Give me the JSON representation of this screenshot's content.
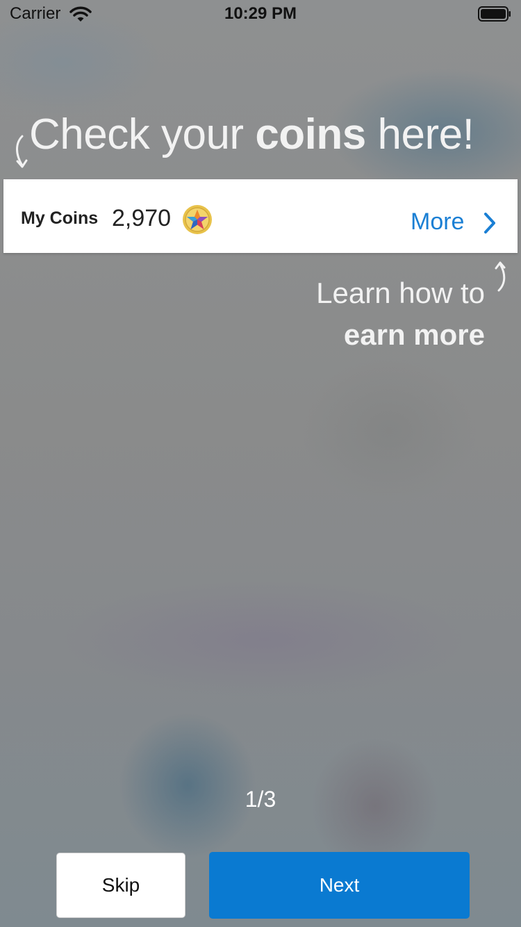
{
  "status_bar": {
    "carrier": "Carrier",
    "time": "10:29 PM"
  },
  "headline": {
    "prefix": "Check your ",
    "bold": "coins",
    "suffix": " here!"
  },
  "coins_card": {
    "label": "My Coins",
    "value": "2,970",
    "more_label": "More"
  },
  "learn_more": {
    "line1": "Learn how to",
    "line2": "earn more"
  },
  "pager": {
    "text": "1/3"
  },
  "buttons": {
    "skip_label": "Skip",
    "next_label": "Next"
  },
  "colors": {
    "accent": "#0a7ad1",
    "link": "#1a7fd4"
  },
  "icons": [
    "wifi-icon",
    "battery-icon",
    "arrow-left-icon",
    "coin-icon",
    "chevron-right-icon",
    "arrow-right-icon"
  ]
}
